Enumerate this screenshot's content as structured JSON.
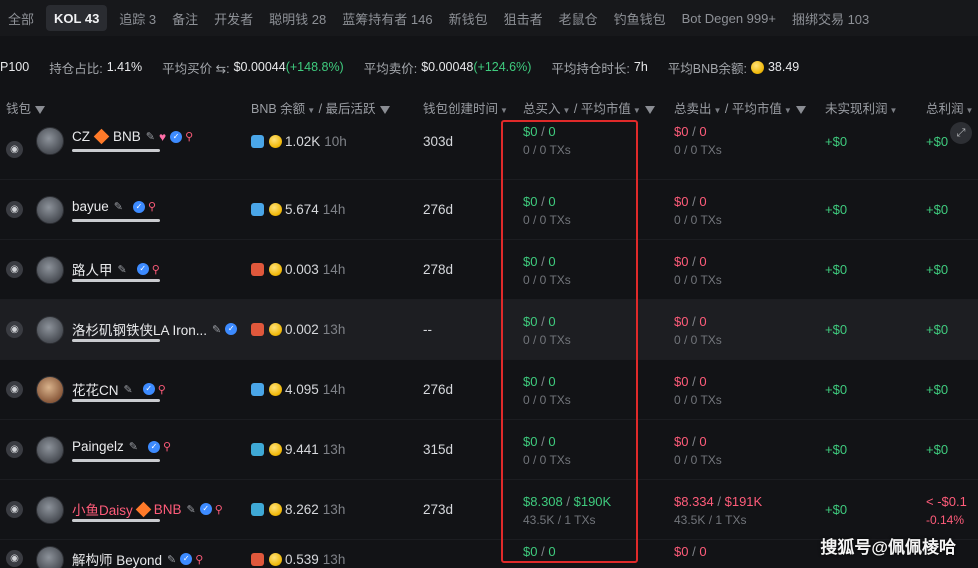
{
  "tabs": [
    "全部",
    "KOL 43",
    "追踪 3",
    "备注",
    "开发者",
    "聪明钱 28",
    "蓝筹持有者 146",
    "新钱包",
    "狙击者",
    "老鼠仓",
    "钓鱼钱包",
    "Bot Degen 999+",
    "捆绑交易 103"
  ],
  "stats": {
    "top": "P100",
    "hold_label": "持仓占比:",
    "hold_value": "1.41%",
    "avg_buy_label": "平均买价 ⇆:",
    "avg_buy_value": "$0.00044",
    "avg_buy_change": "(+148.8%)",
    "avg_sell_label": "平均卖价:",
    "avg_sell_value": "$0.00048",
    "avg_sell_change": "(+124.6%)",
    "avg_hold_label": "平均持仓时长:",
    "avg_hold_value": "7h",
    "avg_bnb_label": "平均BNB余额:",
    "avg_bnb_value": "38.49"
  },
  "columns": {
    "wallet": "钱包",
    "bnb_balance": "BNB 余额",
    "last_active": "最后活跃",
    "created": "钱包创建时间",
    "total_buy": "总买入",
    "avg_mcap_buy": "平均市值",
    "total_sell": "总卖出",
    "avg_mcap_sell": "平均市值",
    "unrealized": "未实现利润",
    "total_profit": "总利润"
  },
  "rows": [
    {
      "name": "CZ",
      "tag": "BNB",
      "bnb": "1.02K",
      "age": "10h",
      "created": "303d",
      "buy": "$0",
      "buy_mcap": "0",
      "buy_sub": "0 / 0 TXs",
      "sell": "$0",
      "sell_mcap": "0",
      "sell_sub": "0 / 0 TXs",
      "unrealized": "+$0",
      "profit": "+$0",
      "profit_sub": ""
    },
    {
      "name": "bayue",
      "tag": "",
      "bnb": "5.674",
      "age": "14h",
      "created": "276d",
      "buy": "$0",
      "buy_mcap": "0",
      "buy_sub": "0 / 0 TXs",
      "sell": "$0",
      "sell_mcap": "0",
      "sell_sub": "0 / 0 TXs",
      "unrealized": "+$0",
      "profit": "+$0",
      "profit_sub": ""
    },
    {
      "name": "路人甲",
      "tag": "",
      "bnb": "0.003",
      "age": "14h",
      "created": "278d",
      "buy": "$0",
      "buy_mcap": "0",
      "buy_sub": "0 / 0 TXs",
      "sell": "$0",
      "sell_mcap": "0",
      "sell_sub": "0 / 0 TXs",
      "unrealized": "+$0",
      "profit": "+$0",
      "profit_sub": ""
    },
    {
      "name": "洛杉矶钢铁侠LA Iron...",
      "tag": "",
      "bnb": "0.002",
      "age": "13h",
      "created": "--",
      "buy": "$0",
      "buy_mcap": "0",
      "buy_sub": "0 / 0 TXs",
      "sell": "$0",
      "sell_mcap": "0",
      "sell_sub": "0 / 0 TXs",
      "unrealized": "+$0",
      "profit": "+$0",
      "profit_sub": ""
    },
    {
      "name": "花花CN",
      "tag": "",
      "bnb": "4.095",
      "age": "14h",
      "created": "276d",
      "buy": "$0",
      "buy_mcap": "0",
      "buy_sub": "0 / 0 TXs",
      "sell": "$0",
      "sell_mcap": "0",
      "sell_sub": "0 / 0 TXs",
      "unrealized": "+$0",
      "profit": "+$0",
      "profit_sub": ""
    },
    {
      "name": "Paingelz",
      "tag": "",
      "bnb": "9.441",
      "age": "13h",
      "created": "315d",
      "buy": "$0",
      "buy_mcap": "0",
      "buy_sub": "0 / 0 TXs",
      "sell": "$0",
      "sell_mcap": "0",
      "sell_sub": "0 / 0 TXs",
      "unrealized": "+$0",
      "profit": "+$0",
      "profit_sub": ""
    },
    {
      "name": "小鱼Daisy",
      "tag": "BNB",
      "bnb": "8.262",
      "age": "13h",
      "created": "273d",
      "buy": "$8.308",
      "buy_mcap": "$190K",
      "buy_sub": "43.5K / 1 TXs",
      "sell": "$8.334",
      "sell_mcap": "$191K",
      "sell_sub": "43.5K / 1 TXs",
      "unrealized": "+$0",
      "profit": "< -$0.1",
      "profit_sub": "-0.14%"
    },
    {
      "name": "解构师 Beyond",
      "tag": "",
      "bnb": "0.539",
      "age": "13h",
      "created": "",
      "buy": "$0",
      "buy_mcap": "0",
      "buy_sub": "",
      "sell": "$0",
      "sell_mcap": "0",
      "sell_sub": "",
      "unrealized": "",
      "profit": "",
      "profit_sub": ""
    }
  ],
  "watermark": "搜狐号@佩佩棱哈",
  "colors": {
    "positive": "#3fcb7e",
    "negative": "#ff5c7a",
    "highlight_box": "#e02a2a",
    "background": "#121316"
  }
}
